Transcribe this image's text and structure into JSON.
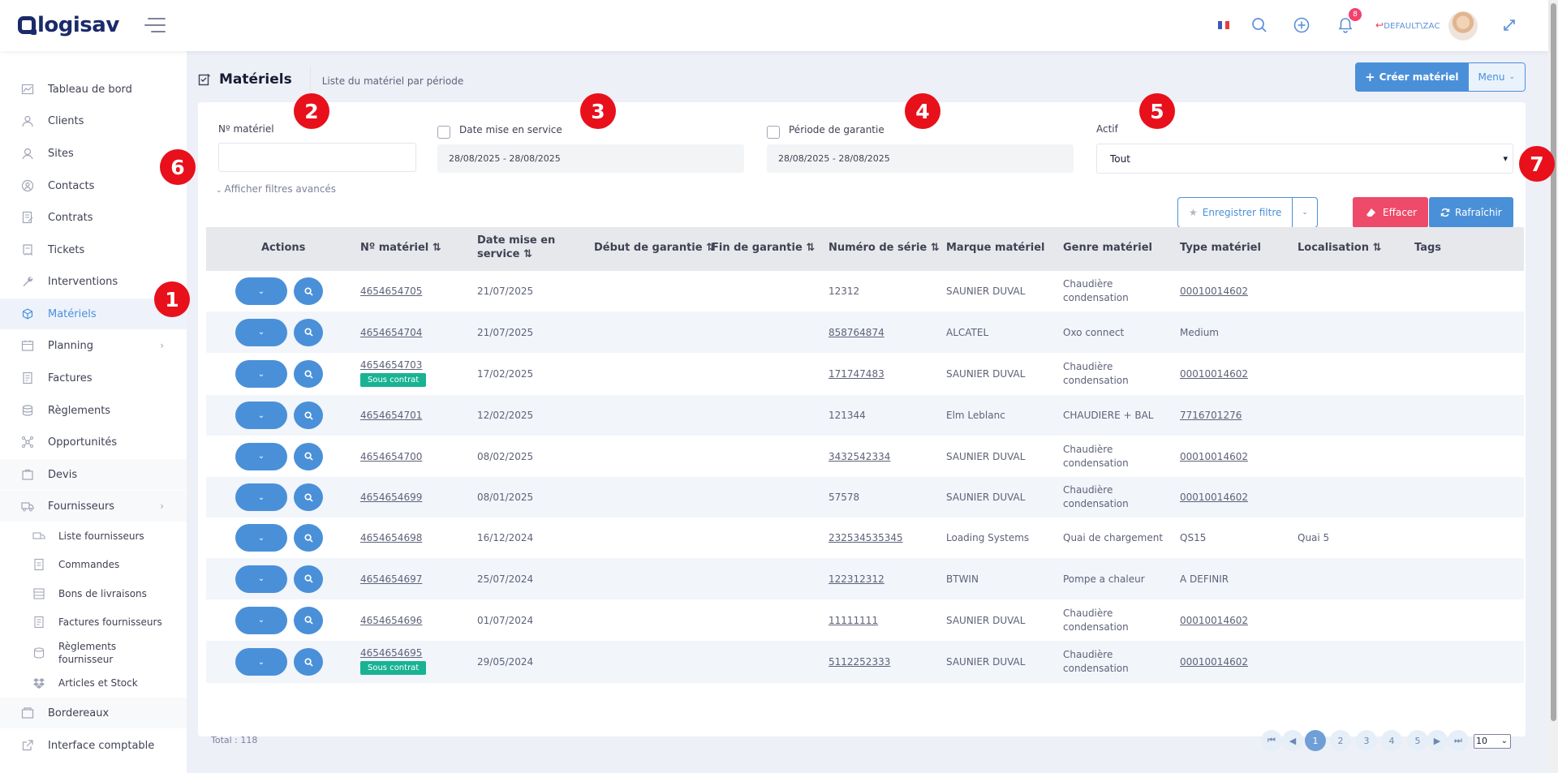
{
  "app": {
    "logo_text": "logisav",
    "user_label": "DEFAULT\\ZAC",
    "notif_count": "8",
    "accent": "#4a90d9",
    "danger": "#ee4a6a",
    "success": "#19b394"
  },
  "sidebar": {
    "items": [
      {
        "label": "Tableau de bord",
        "icon": "chart-icon"
      },
      {
        "label": "Clients",
        "icon": "client-icon"
      },
      {
        "label": "Sites",
        "icon": "location-icon"
      },
      {
        "label": "Contacts",
        "icon": "contact-icon"
      },
      {
        "label": "Contrats",
        "icon": "contract-icon"
      },
      {
        "label": "Tickets",
        "icon": "ticket-icon"
      },
      {
        "label": "Interventions",
        "icon": "wrench-icon"
      },
      {
        "label": "Matériels",
        "icon": "box-icon",
        "active": true
      },
      {
        "label": "Planning",
        "icon": "calendar-icon"
      },
      {
        "label": "Factures",
        "icon": "invoice-icon"
      },
      {
        "label": "Règlements",
        "icon": "payment-icon"
      },
      {
        "label": "Opportunités",
        "icon": "opportunity-icon"
      },
      {
        "label": "Devis",
        "icon": "quote-icon"
      },
      {
        "label": "Fournisseurs",
        "icon": "truck-icon"
      }
    ],
    "sub_items": [
      {
        "label": "Liste fournisseurs"
      },
      {
        "label": "Commandes"
      },
      {
        "label": "Bons de livraisons"
      },
      {
        "label": "Factures fournisseurs"
      },
      {
        "label": "Règlements fournisseur"
      },
      {
        "label": "Articles et Stock"
      }
    ],
    "bottom_items": [
      {
        "label": "Bordereaux"
      },
      {
        "label": "Interface comptable"
      }
    ]
  },
  "page": {
    "title": "Matériels",
    "subtitle": "Liste du matériel par période",
    "create_button": "Créer matériel",
    "menu_button": "Menu"
  },
  "filters": {
    "materiel_label": "Nº matériel",
    "materiel_value": "",
    "date_mise_label": "Date mise en service",
    "date_mise_value": "28/08/2025 - 28/08/2025",
    "garantie_label": "Période de garantie",
    "garantie_value": "28/08/2025 - 28/08/2025",
    "actif_label": "Actif",
    "actif_value": "Tout",
    "advanced_link": "Afficher filtres avancés",
    "save_filter": "Enregistrer filtre",
    "clear": "Effacer",
    "refresh": "Rafraîchir"
  },
  "table": {
    "headers": [
      "Actions",
      "Nº matériel ⇅",
      "Date mise en service ⇅",
      "Début de garantie ⇅",
      "Fin de garantie ⇅",
      "Numéro de série ⇅",
      "Marque matériel",
      "Genre matériel",
      "Type matériel",
      "Localisation ⇅",
      "Tags"
    ],
    "rows": [
      {
        "num": "4654654705",
        "date": "21/07/2025",
        "tag": "",
        "serie": "12312",
        "serie_link": false,
        "marque": "SAUNIER DUVAL",
        "genre": "Chaudière",
        "genre2": "condensation",
        "type": "00010014602",
        "type_link": true,
        "loc": ""
      },
      {
        "num": "4654654704",
        "date": "21/07/2025",
        "tag": "",
        "serie": "858764874",
        "serie_link": true,
        "marque": "ALCATEL",
        "genre": "Oxo connect",
        "genre2": "",
        "type": "Medium",
        "type_link": false,
        "loc": ""
      },
      {
        "num": "4654654703",
        "date": "17/02/2025",
        "tag": "Sous contrat",
        "serie": "171747483",
        "serie_link": true,
        "marque": "SAUNIER DUVAL",
        "genre": "Chaudière",
        "genre2": "condensation",
        "type": "00010014602",
        "type_link": true,
        "loc": ""
      },
      {
        "num": "4654654701",
        "date": "12/02/2025",
        "tag": "",
        "serie": "121344",
        "serie_link": false,
        "marque": "Elm Leblanc",
        "genre": "CHAUDIERE + BAL",
        "genre2": "",
        "type": "7716701276",
        "type_link": true,
        "loc": ""
      },
      {
        "num": "4654654700",
        "date": "08/02/2025",
        "tag": "",
        "serie": "3432542334",
        "serie_link": true,
        "marque": "SAUNIER DUVAL",
        "genre": "Chaudière",
        "genre2": "condensation",
        "type": "00010014602",
        "type_link": true,
        "loc": ""
      },
      {
        "num": "4654654699",
        "date": "08/01/2025",
        "tag": "",
        "serie": "57578",
        "serie_link": false,
        "marque": "SAUNIER DUVAL",
        "genre": "Chaudière",
        "genre2": "condensation",
        "type": "00010014602",
        "type_link": true,
        "loc": ""
      },
      {
        "num": "4654654698",
        "date": "16/12/2024",
        "tag": "",
        "serie": "232534535345",
        "serie_link": true,
        "marque": "Loading Systems",
        "genre": "Quai de chargement",
        "genre2": "",
        "type": "QS15",
        "type_link": false,
        "loc": "Quai 5"
      },
      {
        "num": "4654654697",
        "date": "25/07/2024",
        "tag": "",
        "serie": "122312312",
        "serie_link": true,
        "marque": "BTWIN",
        "genre": "Pompe a chaleur",
        "genre2": "",
        "type": "A DEFINIR",
        "type_link": false,
        "loc": ""
      },
      {
        "num": "4654654696",
        "date": "01/07/2024",
        "tag": "",
        "serie": "11111111",
        "serie_link": true,
        "marque": "SAUNIER DUVAL",
        "genre": "Chaudière",
        "genre2": "condensation",
        "type": "00010014602",
        "type_link": true,
        "loc": ""
      },
      {
        "num": "4654654695",
        "date": "29/05/2024",
        "tag": "Sous contrat",
        "serie": "5112252333",
        "serie_link": true,
        "marque": "SAUNIER DUVAL",
        "genre": "Chaudière",
        "genre2": "condensation",
        "type": "00010014602",
        "type_link": true,
        "loc": ""
      }
    ],
    "total": "Total : 118"
  },
  "pagination": {
    "pages": [
      "1",
      "2",
      "3",
      "4",
      "5"
    ],
    "current": "1",
    "page_size": "10"
  },
  "markers": [
    "1",
    "2",
    "3",
    "4",
    "5",
    "6",
    "7"
  ]
}
